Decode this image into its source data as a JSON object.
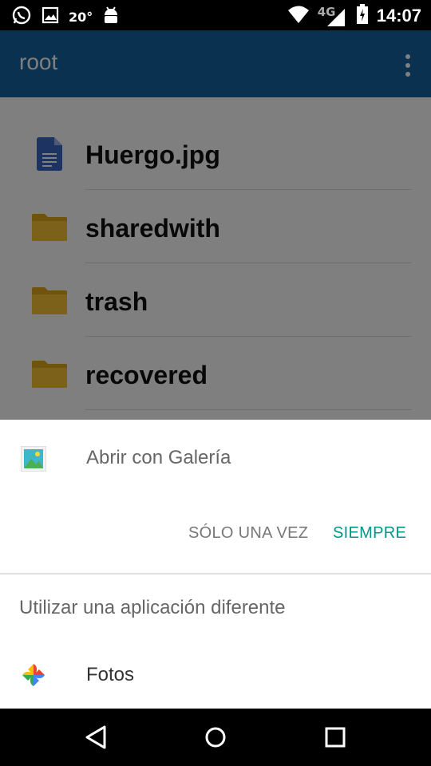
{
  "status_bar": {
    "temperature": "20°",
    "network": "4G",
    "time": "14:07",
    "icons": [
      "whatsapp-icon",
      "image-icon",
      "android-icon",
      "wifi-icon",
      "signal-icon",
      "battery-icon"
    ]
  },
  "app_bar": {
    "title": "root",
    "menu_icon": "more-vert-icon",
    "color": "#1565a0"
  },
  "files": [
    {
      "name": "Huergo.jpg",
      "icon": "document-icon"
    },
    {
      "name": "sharedwith",
      "icon": "folder-icon"
    },
    {
      "name": "trash",
      "icon": "folder-icon"
    },
    {
      "name": "recovered",
      "icon": "folder-icon"
    }
  ],
  "dialog": {
    "open_with": "Abrir con Galería",
    "once_button": "SÓLO UNA VEZ",
    "always_button": "SIEMPRE",
    "other_title": "Utilizar una aplicación diferente",
    "apps": [
      {
        "name": "Fotos",
        "icon": "google-photos-icon"
      }
    ],
    "accent": "#009688"
  },
  "nav_bar": {
    "icons": [
      "back-icon",
      "home-icon",
      "recents-icon"
    ]
  }
}
